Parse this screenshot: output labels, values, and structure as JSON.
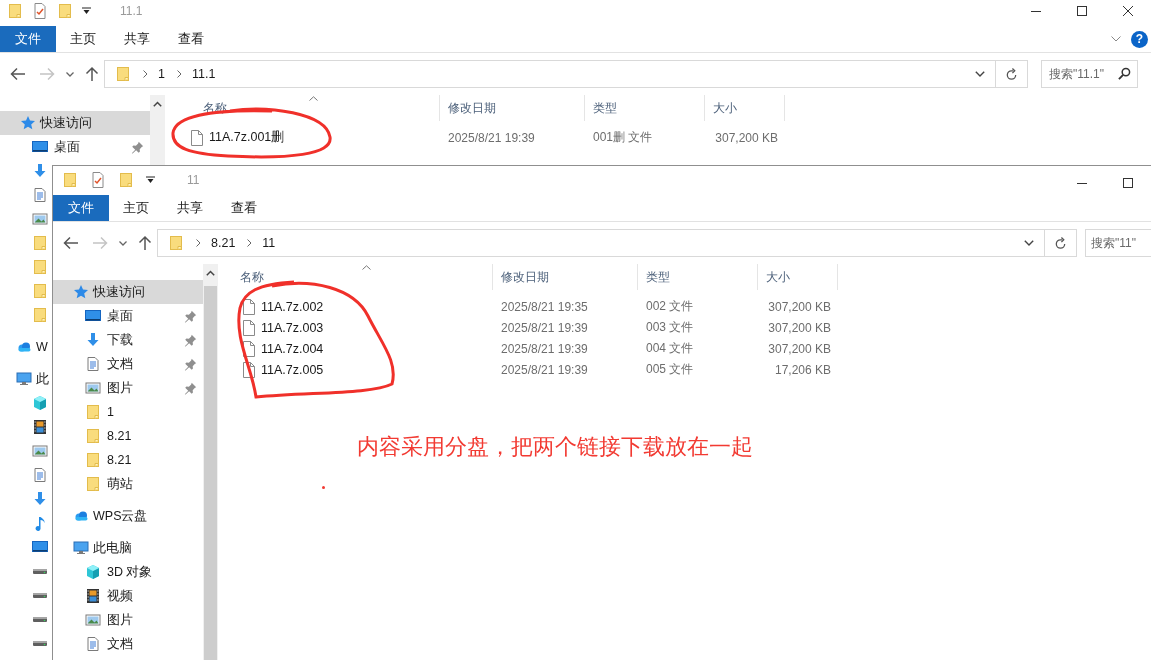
{
  "windows": [
    {
      "title": "11.1",
      "window_buttons": [
        {
          "kind": "minimize"
        },
        {
          "kind": "maximize"
        },
        {
          "kind": "close"
        }
      ],
      "ribbon_tabs": [
        {
          "label": "文件",
          "selected": true
        },
        {
          "label": "主页",
          "selected": false
        },
        {
          "label": "共享",
          "selected": false
        },
        {
          "label": "查看",
          "selected": false
        }
      ],
      "help_glyph": "?",
      "breadcrumb": [
        "1",
        "11.1"
      ],
      "search": {
        "placeholder": "搜索\"11.1\""
      },
      "sidebar": [
        {
          "kind": "quick-access",
          "label": "快速访问",
          "selected": true,
          "children": [
            {
              "kind": "desktop",
              "label": "桌面",
              "pinned": true,
              "selected": false
            },
            {
              "kind": "downloads",
              "pinned": false,
              "selected": false
            },
            {
              "kind": "documents",
              "pinned": false,
              "selected": false
            },
            {
              "kind": "pictures",
              "pinned": false,
              "selected": false
            },
            {
              "kind": "folder",
              "pinned": false,
              "selected": false
            },
            {
              "kind": "folder",
              "pinned": false,
              "selected": false
            },
            {
              "kind": "folder",
              "pinned": false,
              "selected": false
            },
            {
              "kind": "folder",
              "pinned": false,
              "selected": false
            }
          ]
        },
        {
          "kind": "cloud",
          "label": "W",
          "selected": false
        },
        {
          "kind": "computer",
          "label": "此",
          "selected": false,
          "children": [
            {
              "kind": "objects",
              "pinned": false,
              "selected": false
            },
            {
              "kind": "videos",
              "pinned": false,
              "selected": false
            },
            {
              "kind": "pictures",
              "pinned": false,
              "selected": false
            },
            {
              "kind": "documents",
              "pinned": false,
              "selected": false
            },
            {
              "kind": "downloads",
              "pinned": false,
              "selected": false
            },
            {
              "kind": "music",
              "pinned": false,
              "selected": false
            },
            {
              "kind": "desktop",
              "pinned": false,
              "selected": false
            },
            {
              "kind": "drive",
              "pinned": false,
              "selected": false
            },
            {
              "kind": "drive",
              "pinned": false,
              "selected": false
            },
            {
              "kind": "drive",
              "pinned": false,
              "selected": false
            },
            {
              "kind": "drive",
              "pinned": false,
              "selected": false
            }
          ]
        }
      ],
      "columns": [
        "名称",
        "修改日期",
        "类型",
        "大小"
      ],
      "files": [
        {
          "name": "11A.7z.001删",
          "date": "2025/8/21 19:39",
          "type": "001删 文件",
          "size": "307,200 KB"
        }
      ]
    },
    {
      "title": "11",
      "window_buttons": [
        {
          "kind": "minimize"
        },
        {
          "kind": "maximize"
        }
      ],
      "ribbon_tabs": [
        {
          "label": "文件",
          "selected": true
        },
        {
          "label": "主页",
          "selected": false
        },
        {
          "label": "共享",
          "selected": false
        },
        {
          "label": "查看",
          "selected": false
        }
      ],
      "breadcrumb": [
        "8.21",
        "11"
      ],
      "search": {
        "placeholder": "搜索\"11\""
      },
      "sidebar": [
        {
          "kind": "quick-access",
          "label": "快速访问",
          "selected": true,
          "children": [
            {
              "kind": "desktop",
              "label": "桌面",
              "pinned": true,
              "selected": false
            },
            {
              "kind": "downloads",
              "label": "下载",
              "pinned": true,
              "selected": false
            },
            {
              "kind": "documents",
              "label": "文档",
              "pinned": true,
              "selected": false
            },
            {
              "kind": "pictures",
              "label": "图片",
              "pinned": true,
              "selected": false
            },
            {
              "kind": "folder",
              "label": "1",
              "pinned": false,
              "selected": false
            },
            {
              "kind": "folder",
              "label": "8.21",
              "pinned": false,
              "selected": false
            },
            {
              "kind": "folder",
              "label": "8.21",
              "pinned": false,
              "selected": false
            },
            {
              "kind": "folder",
              "label": "萌站",
              "pinned": false,
              "selected": false
            }
          ]
        },
        {
          "kind": "cloud",
          "label": "WPS云盘",
          "selected": false
        },
        {
          "kind": "computer",
          "label": "此电脑",
          "selected": false,
          "children": [
            {
              "kind": "objects",
              "label": "3D 对象",
              "pinned": false,
              "selected": false
            },
            {
              "kind": "videos",
              "label": "视频",
              "pinned": false,
              "selected": false
            },
            {
              "kind": "pictures",
              "label": "图片",
              "pinned": false,
              "selected": false
            },
            {
              "kind": "documents",
              "label": "文档",
              "pinned": false,
              "selected": false
            }
          ]
        }
      ],
      "columns": [
        "名称",
        "修改日期",
        "类型",
        "大小"
      ],
      "files": [
        {
          "name": "11A.7z.002",
          "date": "2025/8/21 19:35",
          "type": "002 文件",
          "size": "307,200 KB"
        },
        {
          "name": "11A.7z.003",
          "date": "2025/8/21 19:39",
          "type": "003 文件",
          "size": "307,200 KB"
        },
        {
          "name": "11A.7z.004",
          "date": "2025/8/21 19:39",
          "type": "004 文件",
          "size": "307,200 KB"
        },
        {
          "name": "11A.7z.005",
          "date": "2025/8/21 19:39",
          "type": "005 文件",
          "size": "17,206 KB"
        }
      ],
      "annotation": "内容采用分盘，把两个链接下载放在一起"
    }
  ]
}
